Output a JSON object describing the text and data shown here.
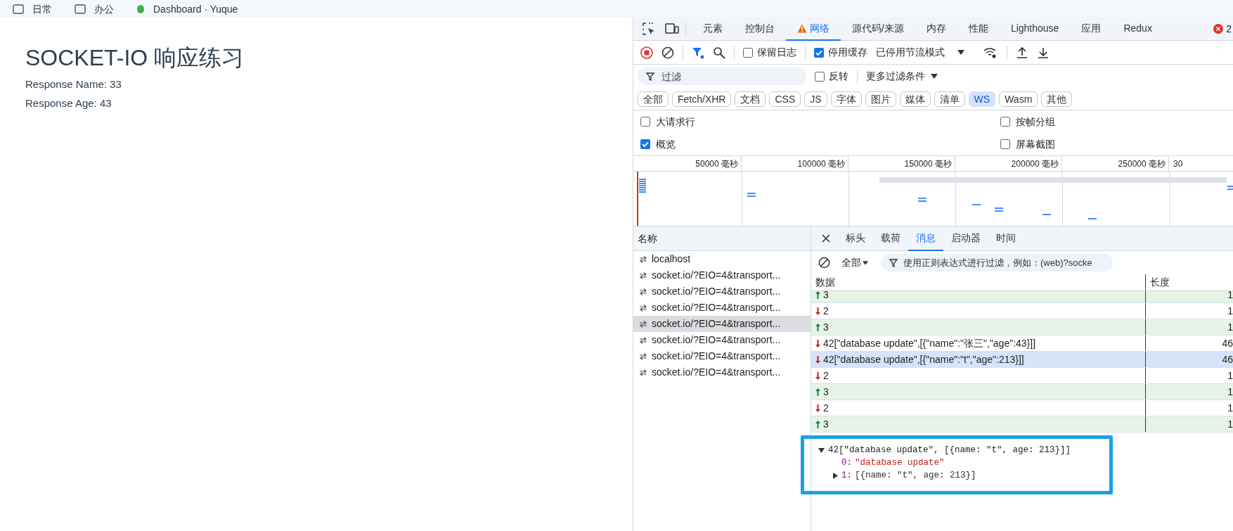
{
  "bookmarks": [
    {
      "label": "日常",
      "kind": "folder"
    },
    {
      "label": "办公",
      "kind": "folder"
    },
    {
      "label": "Dashboard · Yuque",
      "kind": "site"
    }
  ],
  "page": {
    "title": "SOCKET-IO 响应练习",
    "lines": [
      "Response Name: 33",
      "Response Age: 43"
    ]
  },
  "devtools": {
    "tabs": [
      {
        "label": "元素",
        "selected": false,
        "warning": false
      },
      {
        "label": "控制台",
        "selected": false,
        "warning": false
      },
      {
        "label": "网络",
        "selected": true,
        "warning": true
      },
      {
        "label": "源代码/来源",
        "selected": false,
        "warning": false
      },
      {
        "label": "内存",
        "selected": false,
        "warning": false
      },
      {
        "label": "性能",
        "selected": false,
        "warning": false
      },
      {
        "label": "Lighthouse",
        "selected": false,
        "warning": false
      },
      {
        "label": "应用",
        "selected": false,
        "warning": false
      },
      {
        "label": "Redux",
        "selected": false,
        "warning": false
      }
    ],
    "error_count": "2",
    "toolbar": {
      "recording": true,
      "preserve_log": {
        "label": "保留日志",
        "checked": false
      },
      "disable_cache": {
        "label": "停用缓存",
        "checked": true
      },
      "throttle": "已停用节流模式"
    },
    "filter": {
      "placeholder": "过滤",
      "invert": {
        "label": "反转",
        "checked": false
      },
      "more": "更多过滤条件"
    },
    "type_chips": [
      {
        "label": "全部",
        "selected": false
      },
      {
        "label": "Fetch/XHR",
        "selected": false
      },
      {
        "label": "文档",
        "selected": false
      },
      {
        "label": "CSS",
        "selected": false
      },
      {
        "label": "JS",
        "selected": false
      },
      {
        "label": "字体",
        "selected": false
      },
      {
        "label": "图片",
        "selected": false
      },
      {
        "label": "媒体",
        "selected": false
      },
      {
        "label": "清单",
        "selected": false
      },
      {
        "label": "WS",
        "selected": true
      },
      {
        "label": "Wasm",
        "selected": false
      },
      {
        "label": "其他",
        "selected": false
      }
    ],
    "options": [
      {
        "label": "大请求行",
        "checked": false
      },
      {
        "label": "按帧分组",
        "checked": false
      },
      {
        "label": "概览",
        "checked": true
      },
      {
        "label": "屏幕截图",
        "checked": false
      }
    ],
    "timeline_ticks": [
      "50000 毫秒",
      "100000 毫秒",
      "150000 毫秒",
      "200000 毫秒",
      "250000 毫秒",
      "30"
    ],
    "requests": {
      "header": "名称",
      "items": [
        {
          "name": "localhost",
          "selected": false
        },
        {
          "name": "socket.io/?EIO=4&transport...",
          "selected": false
        },
        {
          "name": "socket.io/?EIO=4&transport...",
          "selected": false
        },
        {
          "name": "socket.io/?EIO=4&transport...",
          "selected": false
        },
        {
          "name": "socket.io/?EIO=4&transport...",
          "selected": true
        },
        {
          "name": "socket.io/?EIO=4&transport...",
          "selected": false
        },
        {
          "name": "socket.io/?EIO=4&transport...",
          "selected": false
        },
        {
          "name": "socket.io/?EIO=4&transport...",
          "selected": false
        }
      ]
    },
    "detail_tabs": [
      {
        "label": "标头",
        "selected": false
      },
      {
        "label": "载荷",
        "selected": false
      },
      {
        "label": "消息",
        "selected": true
      },
      {
        "label": "启动器",
        "selected": false
      },
      {
        "label": "时间",
        "selected": false
      }
    ],
    "message_filter": {
      "type": "全部",
      "placeholder": "使用正则表达式进行过滤，例如：(web)?socke"
    },
    "columns": [
      "数据",
      "长度"
    ],
    "messages": [
      {
        "kind": "sent",
        "data": "3",
        "length": "1",
        "selected": false
      },
      {
        "kind": "received",
        "data": "2",
        "length": "1",
        "selected": false
      },
      {
        "kind": "sent",
        "data": "3",
        "length": "1",
        "selected": false
      },
      {
        "kind": "received",
        "data": "42[\"database update\",[{\"name\":\"张三\",\"age\":43}]]",
        "length": "46",
        "selected": false
      },
      {
        "kind": "received",
        "data": "42[\"database update\",[{\"name\":\"t\",\"age\":213}]]",
        "length": "46",
        "selected": true
      },
      {
        "kind": "received",
        "data": "2",
        "length": "1",
        "selected": false
      },
      {
        "kind": "sent",
        "data": "3",
        "length": "1",
        "selected": false
      },
      {
        "kind": "received",
        "data": "2",
        "length": "1",
        "selected": false
      },
      {
        "kind": "sent",
        "data": "3",
        "length": "1",
        "selected": false
      }
    ],
    "preview": {
      "summary": "42[\"database update\", [{name: \"t\", age: 213}]]",
      "expanded": true,
      "children": [
        {
          "key": "0:",
          "value": "\"database update\"",
          "kind": "leaf"
        },
        {
          "key": "1:",
          "value": "[{name: \"t\", age: 213}]",
          "kind": "node",
          "expanded": false
        }
      ]
    }
  }
}
